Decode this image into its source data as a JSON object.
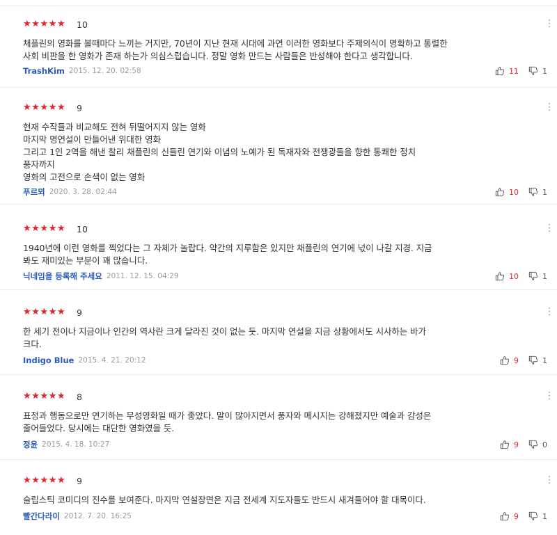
{
  "reviews": [
    {
      "rating": 10,
      "score_label": "10",
      "text": "채플린의 영화를 볼때마다 느끼는 거지만, 70년이 지난 현재 시대에 과연 이러한 영화보다 주제의식이 명확하고 통렬한\n사회 비판을 한 영화가 존재 하는가 의심스럽습니다. 정말 영화 만드는 사람들은 반성해야 한다고 생각합니다.",
      "author": "TrashKim",
      "date": "2015. 12. 20. 02:58",
      "likes": "11",
      "dislikes": "1"
    },
    {
      "rating": 9,
      "score_label": "9",
      "text": "현재 수작들과 비교해도 전혀 뒤떨어지지 않는 영화\n마지막 명연설이 만들어낸 위대한 영화\n그리고 1인 2역을 해낸 찰리 채플린의 신들린 연기와 이념의 노예가 된 독재자와 전쟁광들을 향한 통쾌한 정치\n풍자까지\n영화의 고전으로 손색이 없는 영화",
      "author": "푸르뫼",
      "date": "2020. 3. 28. 02:44",
      "likes": "10",
      "dislikes": "1"
    },
    {
      "rating": 10,
      "score_label": "10",
      "text": "1940년에 이런 영화를 찍었다는 그 자체가 놀랍다. 약간의 지루함은 있지만 채플린의 연기에 넋이 나갈 지경. 지금\n봐도 재미있는 부분이 꽤 많습니다.",
      "author": "닉네임을 등록해 주세요",
      "date": "2011. 12. 15. 04:29",
      "likes": "10",
      "dislikes": "1"
    },
    {
      "rating": 9,
      "score_label": "9",
      "text": "한 세기 전이나 지금이나 인간의 역사란 크게 달라진 것이 없는 듯. 마지막 연설을 지금 상황에서도 시사하는 바가\n크다.",
      "author": "Indigo Blue",
      "date": "2015. 4. 21. 20:12",
      "likes": "9",
      "dislikes": "1"
    },
    {
      "rating": 8,
      "score_label": "8",
      "text": "표정과 행동으로만 연기하는 무성영화일 때가 좋았다. 말이 많아지면서 풍자와 메시지는 강해졌지만 예술과 감성은\n줄어들었다. 당시에는 대단한 영화였을 듯.",
      "author": "정윤",
      "date": "2015. 4. 18. 10:27",
      "likes": "9",
      "dislikes": "0"
    },
    {
      "rating": 9,
      "score_label": "9",
      "text": "슬립스틱 코미디의 진수를 보여준다. 마지막 연설장면은 지금 전세계 지도자들도 반드시 새겨들어야 할 대목이다.",
      "author": "빨간다라이",
      "date": "2012. 7. 20. 16:25",
      "likes": "9",
      "dislikes": "1"
    }
  ],
  "icons": {
    "star": "star-icon",
    "more": "more-vertical-icon",
    "like": "thumbs-up-icon",
    "dislike": "thumbs-down-icon"
  },
  "colors": {
    "star_filled": "#e2242c",
    "star_empty": "#cfcfcf",
    "author": "#2b5cb7",
    "like_count": "#e2242c"
  }
}
